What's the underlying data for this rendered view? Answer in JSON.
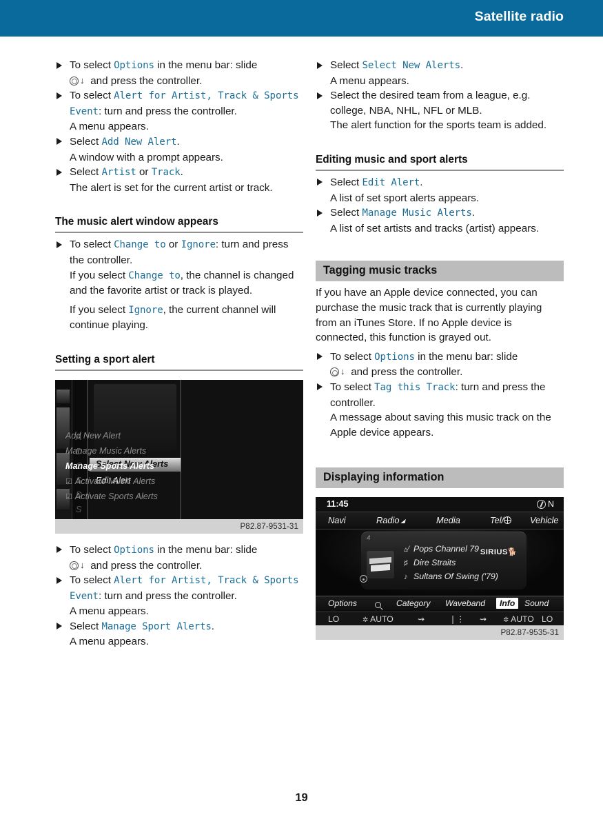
{
  "header": {
    "title": "Satellite radio"
  },
  "page_number": "19",
  "left_column": {
    "blocks": [
      {
        "type": "step",
        "pre": "To select ",
        "ui": "Options",
        "post": " in the menu bar: slide",
        "line2_pre": "",
        "controller": true,
        "line2_post": " and press the controller."
      },
      {
        "type": "step",
        "pre": "To select ",
        "ui": "Alert for Artist, Track & Sports Event",
        "post": ": turn and press the controller.",
        "sub": "A menu appears."
      },
      {
        "type": "step",
        "pre": "Select ",
        "ui": "Add New Alert",
        "post": ".",
        "sub": "A window with a prompt appears."
      },
      {
        "type": "step",
        "pre": "Select ",
        "ui": "Artist",
        "mid": " or ",
        "ui2": "Track",
        "post": ".",
        "sub": "The alert is set for the current artist or track."
      }
    ],
    "heading_music_alert": "The music alert window appears",
    "music_alert_step": {
      "pre": "To select ",
      "ui": "Change to",
      "mid": " or ",
      "ui2": "Ignore",
      "post": ": turn and press the controller."
    },
    "music_alert_sub1_pre": "If you select ",
    "music_alert_sub1_ui": "Change to",
    "music_alert_sub1_post": ", the channel is changed and the favorite artist or track is played.",
    "music_alert_sub2_pre": "If you select ",
    "music_alert_sub2_ui": "Ignore",
    "music_alert_sub2_post": ", the current channel will continue playing.",
    "heading_sport_alert": "Setting a sport alert",
    "after_fig": [
      {
        "pre": "To select ",
        "ui": "Options",
        "post": " in the menu bar: slide",
        "line2_post": " and press the controller."
      },
      {
        "pre": "To select ",
        "ui": "Alert for Artist, Track & Sports Event",
        "post": ": turn and press the controller.",
        "sub": "A menu appears."
      },
      {
        "pre": "Select ",
        "ui": "Manage Sport Alerts",
        "post": ".",
        "sub": "A menu appears."
      }
    ]
  },
  "right_column": {
    "blocks": [
      {
        "pre": "Select ",
        "ui": "Select New Alerts",
        "post": ".",
        "sub": "A menu appears."
      },
      {
        "plain": "Select the desired team from a league, e.g. college, NBA, NHL, NFL or MLB.",
        "sub": "The alert function for the sports team is added."
      }
    ],
    "heading_editing": "Editing music and sport alerts",
    "editing_steps": [
      {
        "pre": "Select ",
        "ui": "Edit Alert",
        "post": ".",
        "sub": "A list of set sport alerts appears."
      },
      {
        "pre": "Select ",
        "ui": "Manage Music Alerts",
        "post": ".",
        "sub": "A list of set artists and tracks (artist) appears."
      }
    ],
    "heading_tagging": "Tagging music tracks",
    "tagging_para": "If you have an Apple device connected, you can purchase the music track that is currently playing from an iTunes Store. If no Apple device is connected, this function is grayed out.",
    "tagging_steps": [
      {
        "pre": "To select ",
        "ui": "Options",
        "post": " in the menu bar: slide",
        "line2_post": " and press the controller."
      },
      {
        "pre": "To select ",
        "ui": "Tag this Track",
        "post": ": turn and press the controller.",
        "sub": "A message about saving this music track on the Apple device appears."
      }
    ],
    "heading_displaying": "Displaying information"
  },
  "figure_alerts": {
    "caption": "P82.87-9531-31",
    "ghost_items": [
      "A",
      "D",
      "C",
      "S",
      "D",
      "S"
    ],
    "selected_item": "Select New Alerts",
    "second_item": "Edit Alert",
    "right_items": [
      {
        "label": "Add New Alert",
        "state": "dim",
        "check": ""
      },
      {
        "label": "Manage Music Alerts",
        "state": "dim",
        "check": ""
      },
      {
        "label": "Manage Sports Alerts",
        "state": "active",
        "check": ""
      },
      {
        "label": "Activate Music Alerts",
        "state": "dim",
        "check": "☑"
      },
      {
        "label": "Activate Sports Alerts",
        "state": "dim",
        "check": "☑"
      }
    ]
  },
  "figure_radio": {
    "caption": "P82.87-9535-31",
    "status": {
      "time": "11:45",
      "compass": "N"
    },
    "menu_items": [
      "Navi",
      "Radio",
      "Media",
      "Tel/",
      "Vehicle"
    ],
    "card": {
      "number": "4",
      "channel": "Pops Channel 79",
      "artist": "Dire Straits",
      "track": "Sultans Of Swing ('79)",
      "brand": "SIRIUS"
    },
    "bottom_items": [
      "Options",
      "Category",
      "Waveband",
      "Info",
      "Sound"
    ],
    "selected_bottom": "Info",
    "climate_items": [
      "LO",
      "AUTO",
      "AUTO",
      "LO"
    ]
  }
}
